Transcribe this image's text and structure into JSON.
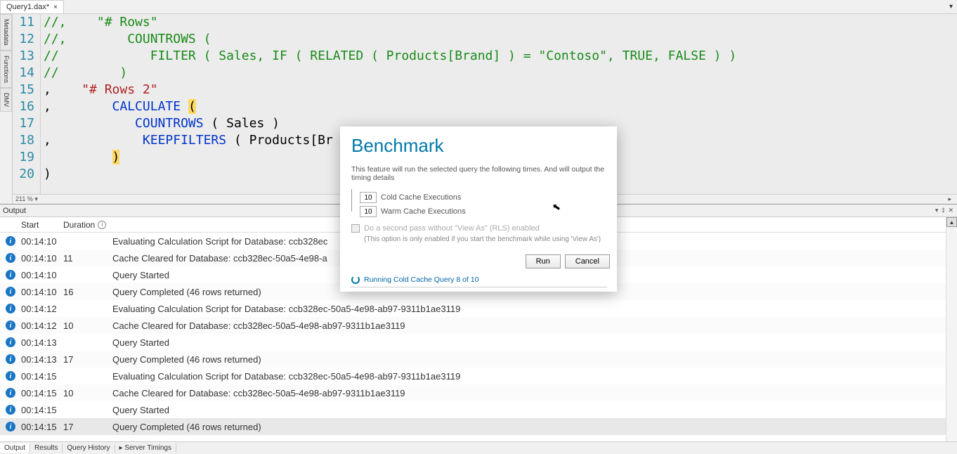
{
  "tab": {
    "title": "Query1.dax*",
    "close": "×"
  },
  "topbar_right": "▾",
  "side_tabs": [
    "Metadata",
    "Functions",
    "DMV"
  ],
  "code": {
    "lines": [
      {
        "n": "11",
        "html": "<span class='tok-comment'>//,    \"# Rows\"</span>"
      },
      {
        "n": "12",
        "html": "<span class='tok-comment'>//,        COUNTROWS (</span>"
      },
      {
        "n": "13",
        "html": "<span class='tok-comment'>//            FILTER ( Sales, IF ( RELATED ( Products[Brand] ) = \"Contoso\", TRUE, FALSE ) )</span>"
      },
      {
        "n": "14",
        "html": "<span class='tok-comment'>//        )</span>"
      },
      {
        "n": "15",
        "html": "<span class='tok-black'>,    </span><span class='tok-string'>\"# Rows 2\"</span>"
      },
      {
        "n": "16",
        "html": "<span class='tok-black'>,        </span><span class='tok-keyword'>CALCULATE</span><span class='tok-black'> </span><span class='hl-paren'>(</span>"
      },
      {
        "n": "17",
        "html": "<span class='tok-black'>            </span><span class='tok-keyword'>COUNTROWS</span><span class='tok-black'> ( Sales )</span>"
      },
      {
        "n": "18",
        "html": "<span class='tok-black'>,            </span><span class='tok-keyword'>KEEPFILTERS</span><span class='tok-black'> ( Products[Br</span>"
      },
      {
        "n": "19",
        "html": "<span class='tok-black'>         </span><span class='hl-paren'>)</span>"
      },
      {
        "n": "20",
        "html": "<span class='tok-black'>)</span>"
      }
    ],
    "zoom": "211 %  ▾",
    "scroll_right_glyph": "▸"
  },
  "output": {
    "title": "Output",
    "header_right": "▾ ‡ ✕",
    "columns": {
      "start": "Start",
      "duration": "Duration"
    },
    "dur_icon": "i",
    "scroll_up": "▲",
    "rows": [
      {
        "start": "00:14:10",
        "dur": "",
        "msg": "Evaluating Calculation Script for Database: ccb328ec"
      },
      {
        "start": "00:14:10",
        "dur": "11",
        "msg": "Cache Cleared for Database: ccb328ec-50a5-4e98-a"
      },
      {
        "start": "00:14:10",
        "dur": "",
        "msg": "Query Started"
      },
      {
        "start": "00:14:10",
        "dur": "16",
        "msg": "Query Completed (46 rows returned)"
      },
      {
        "start": "00:14:12",
        "dur": "",
        "msg": "Evaluating Calculation Script for Database: ccb328ec-50a5-4e98-ab97-9311b1ae3119"
      },
      {
        "start": "00:14:12",
        "dur": "10",
        "msg": "Cache Cleared for Database: ccb328ec-50a5-4e98-ab97-9311b1ae3119"
      },
      {
        "start": "00:14:13",
        "dur": "",
        "msg": "Query Started"
      },
      {
        "start": "00:14:13",
        "dur": "17",
        "msg": "Query Completed (46 rows returned)"
      },
      {
        "start": "00:14:15",
        "dur": "",
        "msg": "Evaluating Calculation Script for Database: ccb328ec-50a5-4e98-ab97-9311b1ae3119"
      },
      {
        "start": "00:14:15",
        "dur": "10",
        "msg": "Cache Cleared for Database: ccb328ec-50a5-4e98-ab97-9311b1ae3119"
      },
      {
        "start": "00:14:15",
        "dur": "",
        "msg": "Query Started"
      },
      {
        "start": "00:14:15",
        "dur": "17",
        "msg": "Query Completed (46 rows returned)",
        "sel": true
      }
    ]
  },
  "bottom_tabs": [
    {
      "label": "Output",
      "active": true
    },
    {
      "label": "Results"
    },
    {
      "label": "Query History"
    },
    {
      "label": "▸ Server Timings"
    }
  ],
  "dialog": {
    "title": "Benchmark",
    "desc": "This feature will run the selected query the following times. And will output the timing details",
    "cold_value": "10",
    "cold_label": "Cold Cache Executions",
    "warm_value": "10",
    "warm_label": "Warm Cache Executions",
    "check_label": "Do a second pass without \"View As\" (RLS) enabled",
    "check_sub": "(This option is only enabled if you start the benchmark while using 'View As')",
    "run": "Run",
    "cancel": "Cancel",
    "status": "Running Cold Cache Query 8 of 10"
  },
  "cursor_glyph": "⬉"
}
